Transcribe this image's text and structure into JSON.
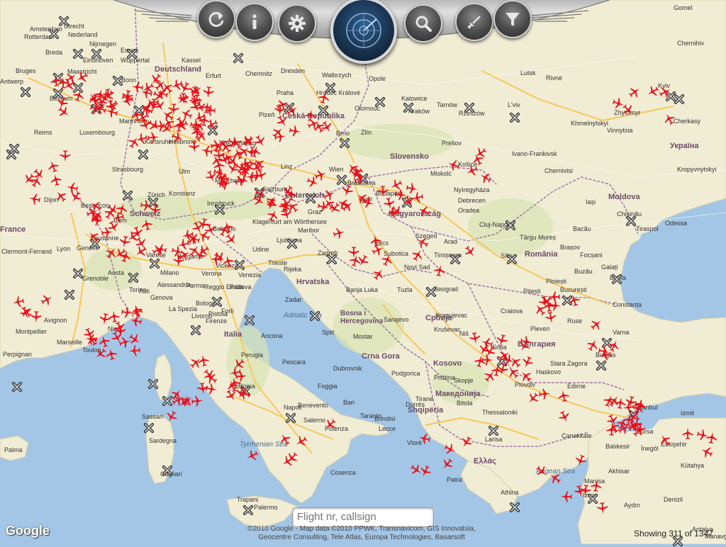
{
  "toolbar": {
    "buttons": [
      {
        "name": "refresh-icon"
      },
      {
        "name": "info-icon"
      },
      {
        "name": "gear-icon"
      },
      {
        "name": "radar-icon"
      },
      {
        "name": "search-icon"
      },
      {
        "name": "location-icon"
      },
      {
        "name": "filter-icon"
      }
    ]
  },
  "search": {
    "placeholder": "Flight nr, callsign",
    "value": ""
  },
  "footer": {
    "google": "Google",
    "copyright_line1": "©2010 Google - Map data ©2010 PPWK, Transnavicom, GIS Innovatsia,",
    "copyright_line2": "Geocentre Consulting, Tele Atlas, Europa Technologies, Basarsoft",
    "showing": "Showing 311 of 1347"
  },
  "colors": {
    "plane": "#e8101a",
    "land": "#f1ecd4",
    "sea": "#a3c6e6",
    "road": "#f5c85a"
  },
  "countries": [
    {
      "label": "Deutschland"
    },
    {
      "label": "Česká Republika"
    },
    {
      "label": "Slovensko"
    },
    {
      "label": "Österreich"
    },
    {
      "label": "Magyarország"
    },
    {
      "label": "România"
    },
    {
      "label": "Україна"
    },
    {
      "label": "Moldova"
    },
    {
      "label": "Schweiz"
    },
    {
      "label": "Italia"
    },
    {
      "label": "Hrvatska"
    },
    {
      "label": "Bosna i Hercegovina"
    },
    {
      "label": "Србија"
    },
    {
      "label": "Crna Gora"
    },
    {
      "label": "България"
    },
    {
      "label": "Македонија"
    },
    {
      "label": "Shqipëria"
    },
    {
      "label": "Ελλάς"
    },
    {
      "label": "Kosovo"
    },
    {
      "label": "France"
    }
  ],
  "cities": [
    {
      "label": "Amsterdam"
    },
    {
      "label": "Rotterdam"
    },
    {
      "label": "Utrecht"
    },
    {
      "label": "Nederland"
    },
    {
      "label": "Nijmegen"
    },
    {
      "label": "Breda"
    },
    {
      "label": "Eindhoven"
    },
    {
      "label": "Essen"
    },
    {
      "label": "Wuppertal"
    },
    {
      "label": "Bruges"
    },
    {
      "label": "Antwerp"
    },
    {
      "label": "Maastricht"
    },
    {
      "label": "Belgium"
    },
    {
      "label": "Bonn"
    },
    {
      "label": "Luxembourg"
    },
    {
      "label": "Kassel"
    },
    {
      "label": "Dresden"
    },
    {
      "label": "Chemnitz"
    },
    {
      "label": "Erfurt"
    },
    {
      "label": "Walbrzych"
    },
    {
      "label": "Opole"
    },
    {
      "label": "Katowice"
    },
    {
      "label": "Kraków"
    },
    {
      "label": "Tarnów"
    },
    {
      "label": "Rzeszów"
    },
    {
      "label": "L'viv"
    },
    {
      "label": "Praha"
    },
    {
      "label": "Plzeň"
    },
    {
      "label": "Brno"
    },
    {
      "label": "Zlín"
    },
    {
      "label": "Olomouc"
    },
    {
      "label": "Hradec Králové"
    },
    {
      "label": "Mannheim"
    },
    {
      "label": "Karlsruhe"
    },
    {
      "label": "Heilbronn"
    },
    {
      "label": "Regensburg"
    },
    {
      "label": "Reims"
    },
    {
      "label": "Strasbourg"
    },
    {
      "label": "Ulm"
    },
    {
      "label": "München"
    },
    {
      "label": "Salzburg"
    },
    {
      "label": "Linz"
    },
    {
      "label": "Wien"
    },
    {
      "label": "Bratislava"
    },
    {
      "label": "Győr"
    },
    {
      "label": "Budapest"
    },
    {
      "label": "Miskolc"
    },
    {
      "label": "Košice"
    },
    {
      "label": "Prešov"
    },
    {
      "label": "Nyíregyháza"
    },
    {
      "label": "Debrecen"
    },
    {
      "label": "Oradea"
    },
    {
      "label": "Cluj-Napoca"
    },
    {
      "label": "Târgu Mureș"
    },
    {
      "label": "Bacău"
    },
    {
      "label": "Iași"
    },
    {
      "label": "Chișinău"
    },
    {
      "label": "Tiraspol"
    },
    {
      "label": "Odessa"
    },
    {
      "label": "Kyiv"
    },
    {
      "label": "Zhytomyr"
    },
    {
      "label": "Vinnytsia"
    },
    {
      "label": "Cherkasy"
    },
    {
      "label": "Khmelnytskyi"
    },
    {
      "label": "Ivano-Frankivsk"
    },
    {
      "label": "Chernivtsi"
    },
    {
      "label": "Kropyvnytskyi"
    },
    {
      "label": "Lutsk"
    },
    {
      "label": "Rivne"
    },
    {
      "label": "Gomel"
    },
    {
      "label": "Chernihiv"
    },
    {
      "label": "Dijon"
    },
    {
      "label": "Besançon"
    },
    {
      "label": "Konstanz"
    },
    {
      "label": "Zürich"
    },
    {
      "label": "Bern"
    },
    {
      "label": "Lausanne"
    },
    {
      "label": "Genève"
    },
    {
      "label": "Innsbruck"
    },
    {
      "label": "Graz"
    },
    {
      "label": "Klagenfurt am Wörthersee"
    },
    {
      "label": "Maribor"
    },
    {
      "label": "Zagreb"
    },
    {
      "label": "Ljubljana"
    },
    {
      "label": "Pécs"
    },
    {
      "label": "Szeged"
    },
    {
      "label": "Arad"
    },
    {
      "label": "Timișoara"
    },
    {
      "label": "Sibiu"
    },
    {
      "label": "Brașov"
    },
    {
      "label": "Ploiești"
    },
    {
      "label": "București"
    },
    {
      "label": "Constanța"
    },
    {
      "label": "Galați"
    },
    {
      "label": "Brăila"
    },
    {
      "label": "Focșani"
    },
    {
      "label": "Buzău"
    },
    {
      "label": "Pitești"
    },
    {
      "label": "Craiova"
    },
    {
      "label": "Clermont-Ferrand"
    },
    {
      "label": "Lyon"
    },
    {
      "label": "Grenoble"
    },
    {
      "label": "Torino"
    },
    {
      "label": "Milano"
    },
    {
      "label": "Bergamo"
    },
    {
      "label": "Verona"
    },
    {
      "label": "Venezia"
    },
    {
      "label": "Vicenza"
    },
    {
      "label": "Padova"
    },
    {
      "label": "Trieste"
    },
    {
      "label": "Rijeka"
    },
    {
      "label": "Bologna"
    },
    {
      "label": "Firenze"
    },
    {
      "label": "Livorno"
    },
    {
      "label": "La Spezia"
    },
    {
      "label": "Genova"
    },
    {
      "label": "Nice"
    },
    {
      "label": "Marseille"
    },
    {
      "label": "Toulon"
    },
    {
      "label": "Montpellier"
    },
    {
      "label": "Perpignan"
    },
    {
      "label": "Avignon"
    },
    {
      "label": "Ancona"
    },
    {
      "label": "Perugia"
    },
    {
      "label": "Roma"
    },
    {
      "label": "Pescara"
    },
    {
      "label": "Napoli"
    },
    {
      "label": "Bari"
    },
    {
      "label": "Taranto"
    },
    {
      "label": "Salerno"
    },
    {
      "label": "Benevento"
    },
    {
      "label": "Foggia"
    },
    {
      "label": "Lecce"
    },
    {
      "label": "Brindisi"
    },
    {
      "label": "Potenza"
    },
    {
      "label": "Cosenza"
    },
    {
      "label": "Palermo"
    },
    {
      "label": "Trapani"
    },
    {
      "label": "Sassari"
    },
    {
      "label": "Sardegna"
    },
    {
      "label": "Cagliari"
    },
    {
      "label": "Palma"
    },
    {
      "label": "Split"
    },
    {
      "label": "Sarajevo"
    },
    {
      "label": "Mostar"
    },
    {
      "label": "Tuzla"
    },
    {
      "label": "Banja Luka"
    },
    {
      "label": "Beograd"
    },
    {
      "label": "Novi Sad"
    },
    {
      "label": "Niš"
    },
    {
      "label": "Kragujevac"
    },
    {
      "label": "Kruševac"
    },
    {
      "label": "Podgorica"
    },
    {
      "label": "Priština"
    },
    {
      "label": "Skopje"
    },
    {
      "label": "Tirane"
    },
    {
      "label": "Durrës"
    },
    {
      "label": "Vlorë"
    },
    {
      "label": "Bitola"
    },
    {
      "label": "Thessaloniki"
    },
    {
      "label": "Larisa"
    },
    {
      "label": "Athina"
    },
    {
      "label": "Patra"
    },
    {
      "label": "Sofia"
    },
    {
      "label": "Pleven"
    },
    {
      "label": "Plovdiv"
    },
    {
      "label": "Varna"
    },
    {
      "label": "Burgas"
    },
    {
      "label": "Ruse"
    },
    {
      "label": "Stara Zagora"
    },
    {
      "label": "Haskovo"
    },
    {
      "label": "Edirne"
    },
    {
      "label": "Istanbul"
    },
    {
      "label": "Izmit"
    },
    {
      "label": "Bursa"
    },
    {
      "label": "Eskişehir"
    },
    {
      "label": "Balıkesir"
    },
    {
      "label": "Manisa"
    },
    {
      "label": "İzmir"
    },
    {
      "label": "Aydın"
    },
    {
      "label": "Denizli"
    },
    {
      "label": "Antalya"
    },
    {
      "label": "Manavgat"
    },
    {
      "label": "Çanakkale"
    },
    {
      "label": "İnegöl"
    },
    {
      "label": "Kütahya"
    },
    {
      "label": "Akhisar"
    },
    {
      "label": "Tyrrhenian Sea"
    },
    {
      "label": "Aegean Sea"
    },
    {
      "label": "Adriatic Sea"
    },
    {
      "label": "Reggio Emilia"
    },
    {
      "label": "Pistoia"
    },
    {
      "label": "Forlì"
    },
    {
      "label": "Parma"
    },
    {
      "label": "Varese"
    },
    {
      "label": "Alessandria"
    },
    {
      "label": "Asti"
    },
    {
      "label": "Aosta"
    },
    {
      "label": "Bolzano"
    },
    {
      "label": "Udine"
    },
    {
      "label": "Subotica"
    },
    {
      "label": "Dubrovnik"
    },
    {
      "label": "Zadar"
    }
  ],
  "planes_count_hint": "many",
  "airports_count_hint": "many"
}
